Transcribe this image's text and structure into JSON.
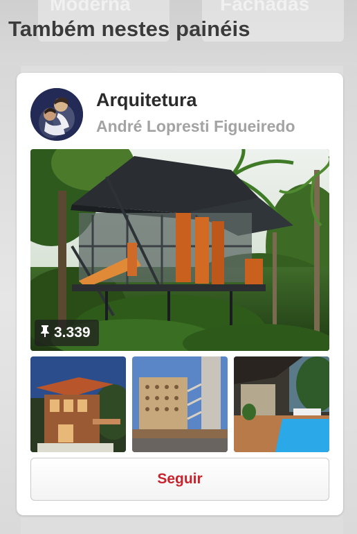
{
  "background": {
    "tiles": [
      "Moderna",
      "Fachadas"
    ]
  },
  "section": {
    "title": "Também nestes painéis"
  },
  "board": {
    "title": "Arquitetura",
    "owner": "André Lopresti Figueiredo",
    "pin_count": "3.339",
    "follow_label": "Seguir"
  },
  "colors": {
    "accent": "#c8232c",
    "title": "#3b3b3b",
    "owner": "#a3a3a3"
  },
  "icons": {
    "pin": "pushpin-icon"
  }
}
